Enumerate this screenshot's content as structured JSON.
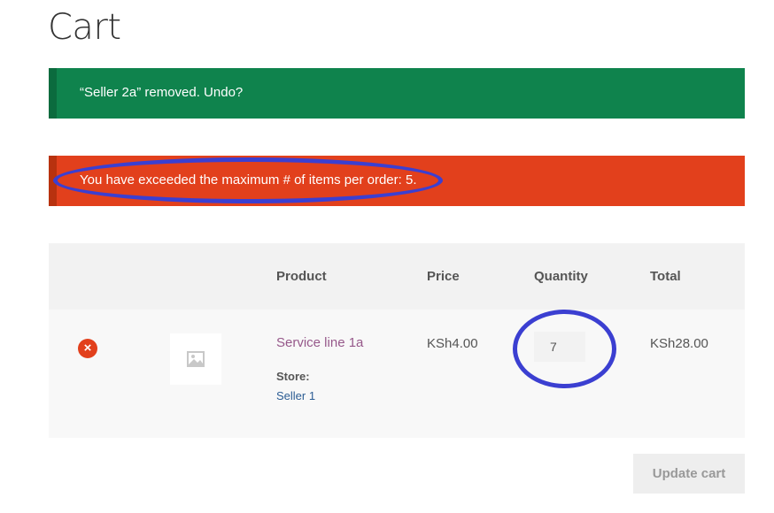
{
  "page": {
    "title": "Cart"
  },
  "notices": {
    "success": "“Seller 2a” removed. Undo?",
    "error": "You have exceeded the maximum # of items per order: 5."
  },
  "table": {
    "headers": {
      "product": "Product",
      "price": "Price",
      "quantity": "Quantity",
      "total": "Total"
    },
    "rows": [
      {
        "remove_icon": "×",
        "product_name": "Service line 1a",
        "store_label": "Store:",
        "store_name": "Seller 1",
        "price": "KSh4.00",
        "quantity": "7",
        "total": "KSh28.00"
      }
    ]
  },
  "actions": {
    "update_cart": "Update cart"
  },
  "colors": {
    "success": "#0f834d",
    "error": "#e2401c",
    "product_link": "#96588a",
    "annotation": "#3b3fd1"
  },
  "icons": [
    "remove-icon",
    "image-placeholder-icon"
  ]
}
